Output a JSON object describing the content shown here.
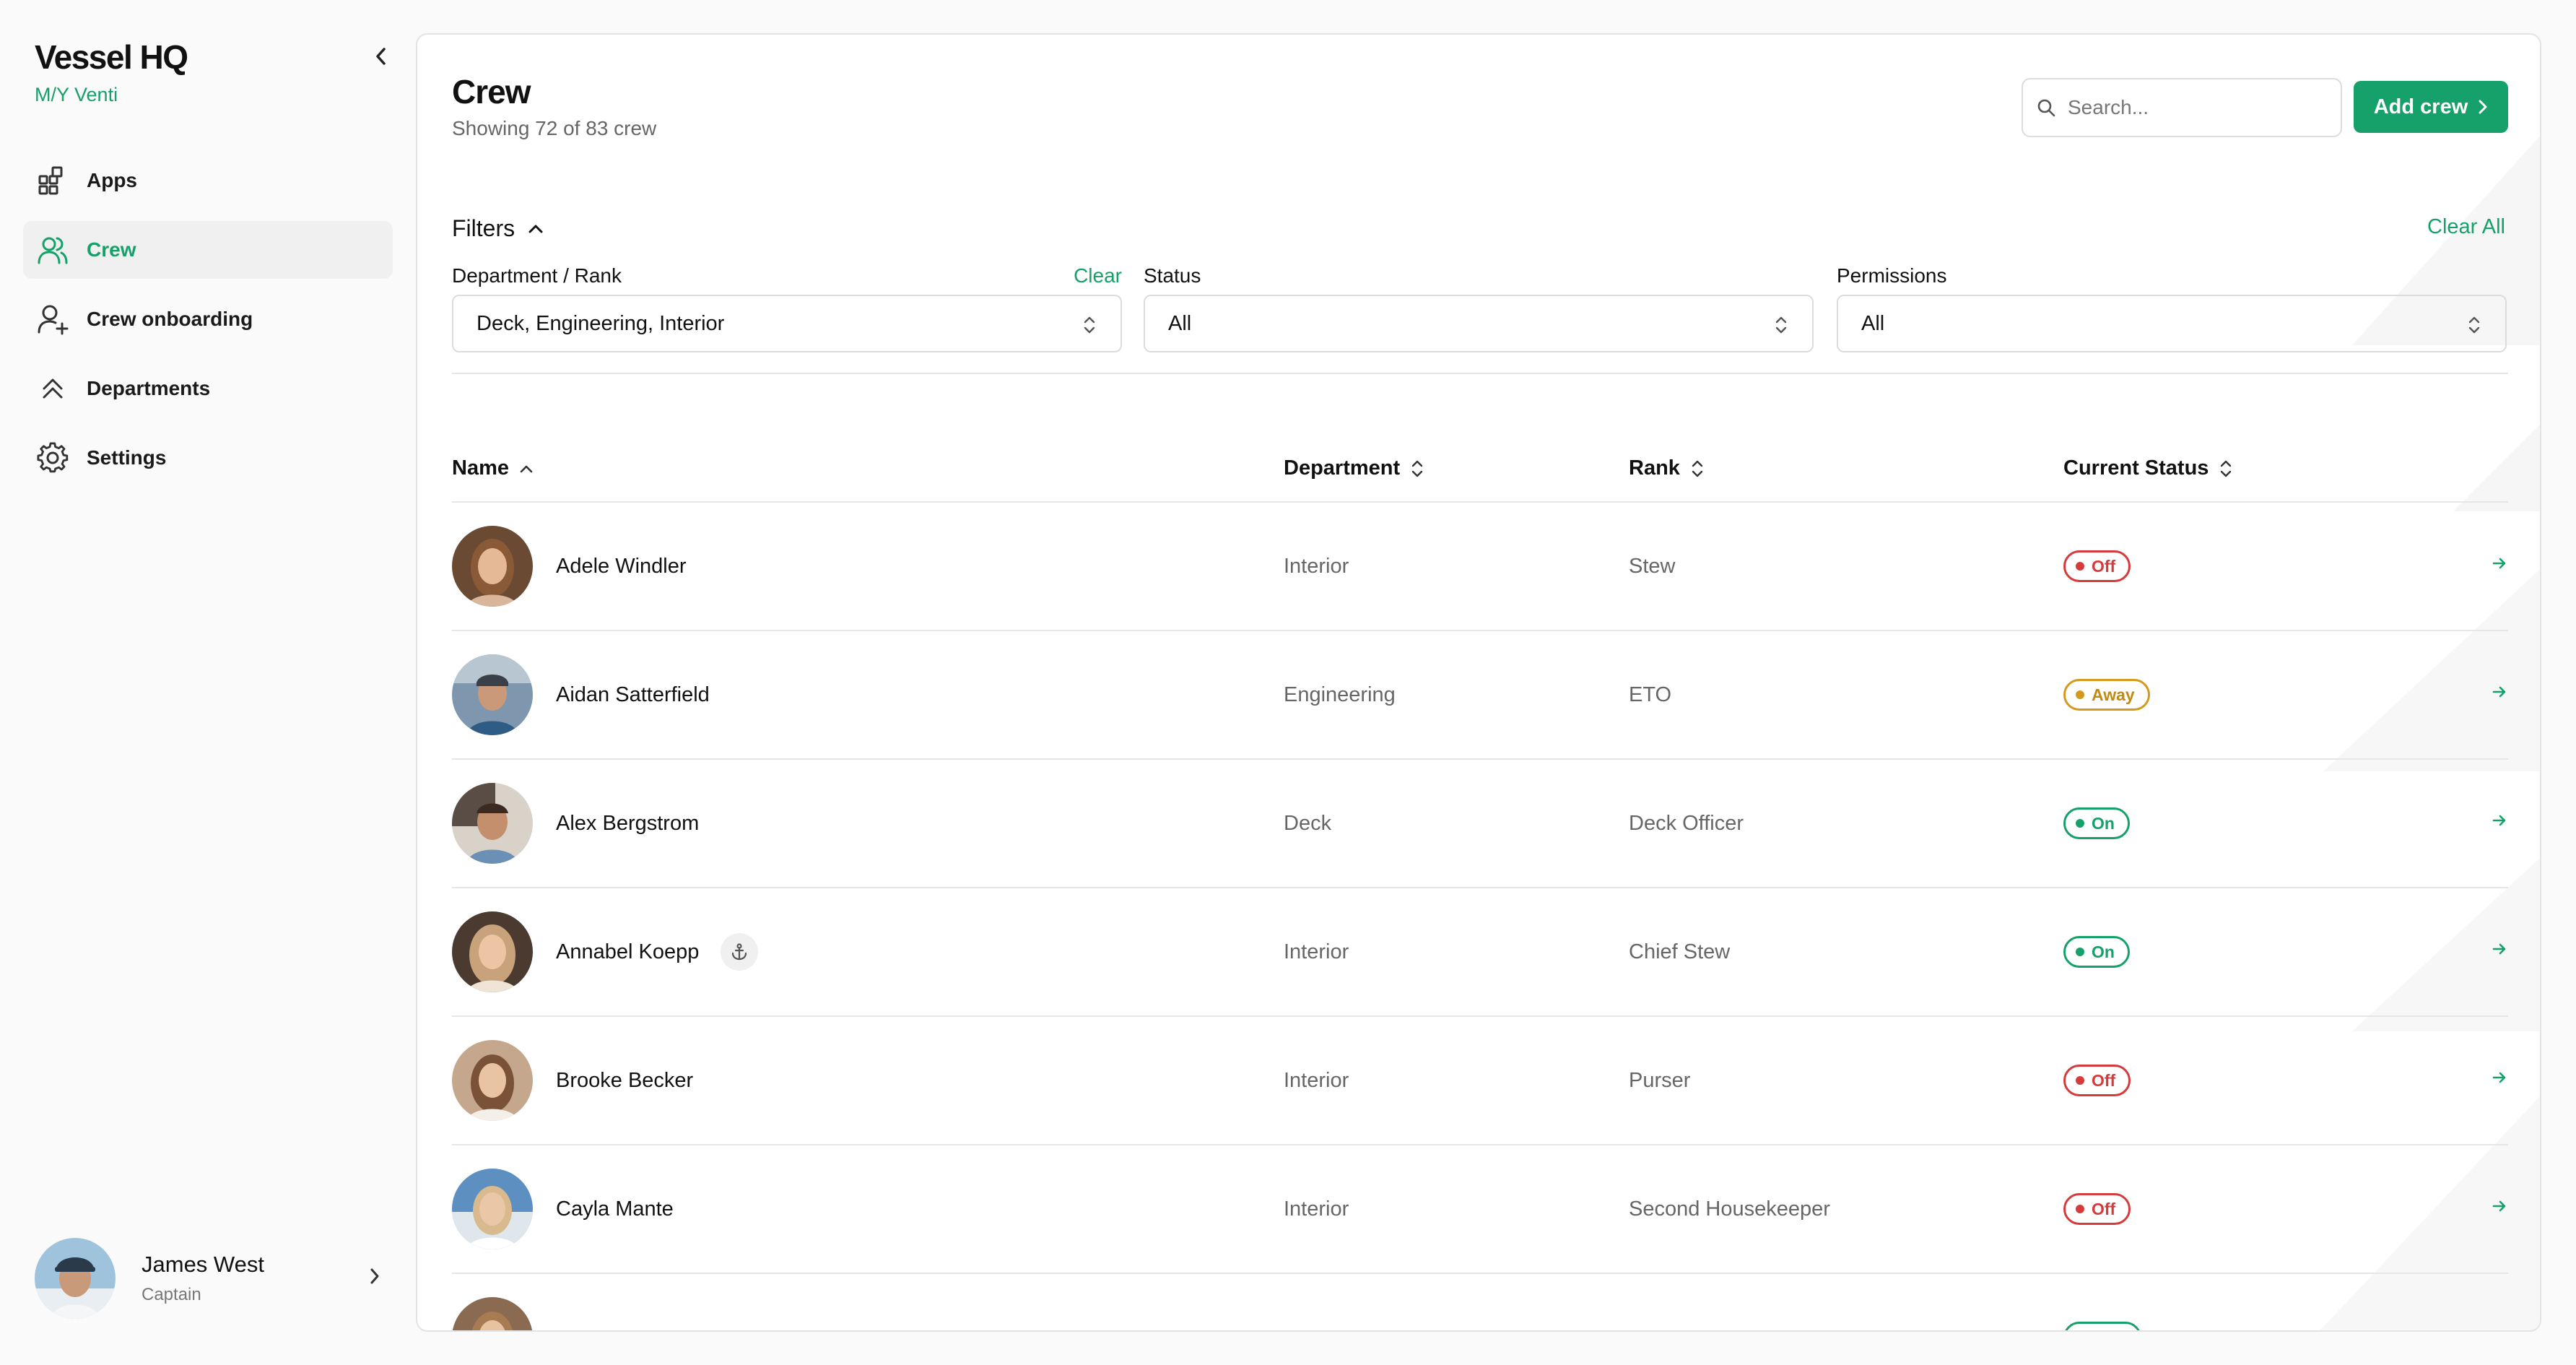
{
  "sidebar": {
    "brand_title": "Vessel HQ",
    "brand_subtitle": "M/Y Venti",
    "items": [
      {
        "label": "Apps",
        "icon": "apps-icon",
        "active": false
      },
      {
        "label": "Crew",
        "icon": "users-icon",
        "active": true
      },
      {
        "label": "Crew onboarding",
        "icon": "user-plus-icon",
        "active": false
      },
      {
        "label": "Departments",
        "icon": "chevrons-up-icon",
        "active": false
      },
      {
        "label": "Settings",
        "icon": "gear-icon",
        "active": false
      }
    ],
    "user": {
      "name": "James West",
      "role": "Captain"
    }
  },
  "header": {
    "title": "Crew",
    "subtitle": "Showing 72 of 83 crew",
    "search_placeholder": "Search...",
    "add_button": "Add crew"
  },
  "filters": {
    "title": "Filters",
    "clear_all": "Clear All",
    "department": {
      "label": "Department / Rank",
      "clear": "Clear",
      "value": "Deck, Engineering, Interior"
    },
    "status": {
      "label": "Status",
      "value": "All"
    },
    "permissions": {
      "label": "Permissions",
      "value": "All"
    }
  },
  "table": {
    "columns": {
      "name": "Name",
      "department": "Department",
      "rank": "Rank",
      "status": "Current Status"
    },
    "rows": [
      {
        "name": "Adele Windler",
        "department": "Interior",
        "rank": "Stew",
        "status": "Off",
        "status_kind": "off"
      },
      {
        "name": "Aidan Satterfield",
        "department": "Engineering",
        "rank": "ETO",
        "status": "Away",
        "status_kind": "away"
      },
      {
        "name": "Alex Bergstrom",
        "department": "Deck",
        "rank": "Deck Officer",
        "status": "On",
        "status_kind": "on"
      },
      {
        "name": "Annabel Koepp",
        "department": "Interior",
        "rank": "Chief Stew",
        "status": "On",
        "status_kind": "on",
        "head_of_department": true
      },
      {
        "name": "Brooke Becker",
        "department": "Interior",
        "rank": "Purser",
        "status": "Off",
        "status_kind": "off"
      },
      {
        "name": "Cayla Mante",
        "department": "Interior",
        "rank": "Second Housekeeper",
        "status": "Off",
        "status_kind": "off"
      }
    ]
  },
  "colors": {
    "accent": "#16a06a",
    "off": "#d63a3a",
    "away": "#d49a1e"
  }
}
